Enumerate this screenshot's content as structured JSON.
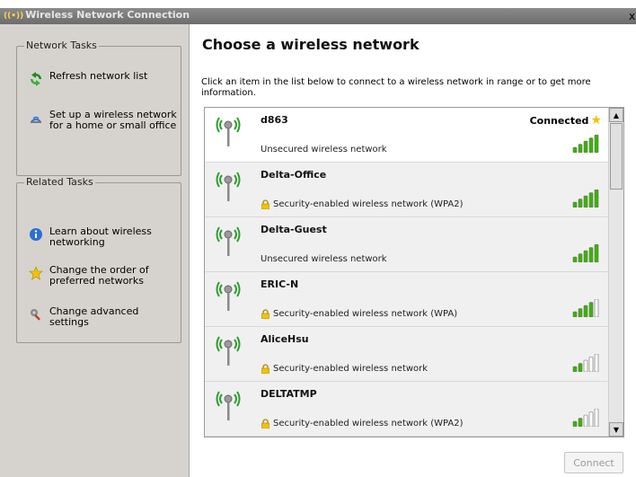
{
  "window": {
    "title": "Wireless Network Connection",
    "close_label": "x"
  },
  "left_pane": {
    "network_tasks": {
      "title": "Network Tasks",
      "items": [
        {
          "label": "Refresh network list",
          "icon": "refresh-icon"
        },
        {
          "label": "Set up a wireless network for a home or small office",
          "icon": "setup-network-icon"
        }
      ]
    },
    "related_tasks": {
      "title": "Related Tasks",
      "items": [
        {
          "label": "Learn about wireless networking",
          "icon": "info-icon"
        },
        {
          "label": "Change the order of preferred networks",
          "icon": "star-icon"
        },
        {
          "label": "Change advanced settings",
          "icon": "settings-icon"
        }
      ]
    }
  },
  "main": {
    "heading": "Choose a wireless network",
    "description": "Click an item in the list below to connect to a wireless network in range or to get more information.",
    "connect_label": "Connect",
    "connected_status": "Connected",
    "networks": [
      {
        "name": "d863",
        "security": "Unsecured wireless network",
        "secured": false,
        "connected": true,
        "signal_bars": 5
      },
      {
        "name": "Delta-Office",
        "security": "Security-enabled wireless network (WPA2)",
        "secured": true,
        "connected": false,
        "signal_bars": 5
      },
      {
        "name": "Delta-Guest",
        "security": "Unsecured wireless network",
        "secured": false,
        "connected": false,
        "signal_bars": 5
      },
      {
        "name": "ERIC-N",
        "security": "Security-enabled wireless network (WPA)",
        "secured": true,
        "connected": false,
        "signal_bars": 4
      },
      {
        "name": "AliceHsu",
        "security": "Security-enabled wireless network",
        "secured": true,
        "connected": false,
        "signal_bars": 2
      },
      {
        "name": "DELTATMP",
        "security": "Security-enabled wireless network (WPA2)",
        "secured": true,
        "connected": false,
        "signal_bars": 2
      }
    ]
  },
  "colors": {
    "signal_on": "#3bb400",
    "signal_off": "#ffffff",
    "accent": "#f2c200"
  }
}
